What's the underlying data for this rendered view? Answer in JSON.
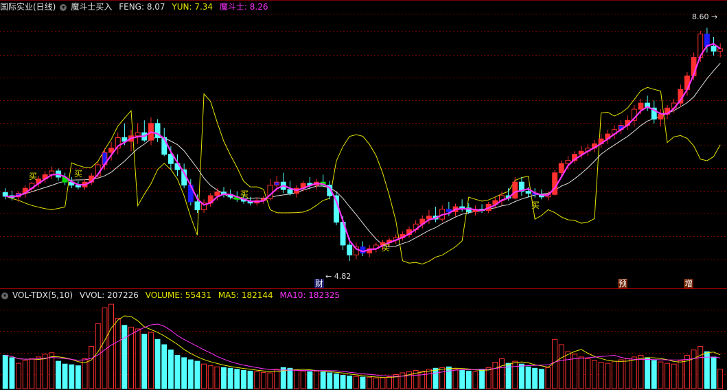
{
  "price_header": {
    "stock_name": "国际实业(日线)",
    "indicator_name": "魔斗士买入",
    "feng_label": "FENG: 8.07",
    "yun_label": "YUN: 7.34",
    "mods_label": "魔斗士: 8.26"
  },
  "volume_header": {
    "indicator_name": "VOL-TDX(5,10)",
    "vvol_label": "VVOL: 207226",
    "volume_label": "VOLUME: 55431",
    "ma5_label": "MA5: 182144",
    "ma10_label": "MA10: 182325"
  },
  "annotations": {
    "high_label": "8.60",
    "low_label": "4.82",
    "buy_signal": "买",
    "cai_marker": "财",
    "yu_marker": "预",
    "zeng_marker": "增"
  },
  "colors": {
    "background": "#000000",
    "grid": "#7a0000",
    "up_candle": "#ff3030",
    "down_candle": "#54ffff",
    "blue_candle": "#1c1cff",
    "green_candle": "#00e000",
    "red_candle": "#ff0000",
    "magenta_line": "#ff33ff",
    "white_line": "#e0e0e0",
    "yellow_line": "#e6e600",
    "header_white": "#e0e0e0",
    "header_yellow": "#e6e600",
    "header_magenta": "#ff33ff"
  },
  "chart_data": {
    "type": "candlestick",
    "title": "国际实业(日线)",
    "ylim": [
      4.6,
      8.85
    ],
    "volume_ylim": [
      0,
      250000
    ],
    "candles": [
      {
        "o": 5.93,
        "h": 6.0,
        "l": 5.82,
        "c": 5.87
      },
      {
        "o": 5.88,
        "h": 5.96,
        "l": 5.8,
        "c": 5.85
      },
      {
        "o": 5.86,
        "h": 5.95,
        "l": 5.78,
        "c": 5.92
      },
      {
        "o": 5.92,
        "h": 6.05,
        "l": 5.85,
        "c": 6.0
      },
      {
        "o": 6.0,
        "h": 6.1,
        "l": 5.95,
        "c": 6.08
      },
      {
        "o": 6.08,
        "h": 6.2,
        "l": 6.02,
        "c": 6.15
      },
      {
        "o": 6.15,
        "h": 6.28,
        "l": 6.08,
        "c": 6.22
      },
      {
        "o": 6.22,
        "h": 6.35,
        "l": 6.15,
        "c": 6.28
      },
      {
        "o": 6.28,
        "h": 6.32,
        "l": 6.12,
        "c": 6.18
      },
      {
        "o": 6.18,
        "h": 6.25,
        "l": 6.05,
        "c": 6.1
      },
      {
        "o": 6.1,
        "h": 6.18,
        "l": 6.0,
        "c": 6.05
      },
      {
        "o": 6.05,
        "h": 6.12,
        "l": 5.98,
        "c": 6.02
      },
      {
        "o": 6.02,
        "h": 6.15,
        "l": 5.97,
        "c": 6.1
      },
      {
        "o": 6.1,
        "h": 6.25,
        "l": 6.05,
        "c": 6.2
      },
      {
        "o": 6.2,
        "h": 6.42,
        "l": 6.15,
        "c": 6.38
      },
      {
        "o": 6.38,
        "h": 6.65,
        "l": 6.3,
        "c": 6.58
      },
      {
        "o": 6.58,
        "h": 6.75,
        "l": 6.45,
        "c": 6.65
      },
      {
        "o": 6.65,
        "h": 6.9,
        "l": 6.55,
        "c": 6.82
      },
      {
        "o": 6.82,
        "h": 7.05,
        "l": 6.7,
        "c": 6.76
      },
      {
        "o": 6.76,
        "h": 6.95,
        "l": 6.6,
        "c": 6.85
      },
      {
        "o": 6.85,
        "h": 7.05,
        "l": 6.72,
        "c": 6.9
      },
      {
        "o": 6.9,
        "h": 7.1,
        "l": 6.75,
        "c": 6.78
      },
      {
        "o": 6.78,
        "h": 7.15,
        "l": 6.7,
        "c": 7.05
      },
      {
        "o": 7.05,
        "h": 7.12,
        "l": 6.75,
        "c": 6.82
      },
      {
        "o": 6.82,
        "h": 6.98,
        "l": 6.52,
        "c": 6.55
      },
      {
        "o": 6.55,
        "h": 6.68,
        "l": 6.3,
        "c": 6.4
      },
      {
        "o": 6.4,
        "h": 6.55,
        "l": 6.2,
        "c": 6.3
      },
      {
        "o": 6.3,
        "h": 6.4,
        "l": 6.0,
        "c": 6.05
      },
      {
        "o": 6.05,
        "h": 6.15,
        "l": 5.72,
        "c": 5.78
      },
      {
        "o": 5.78,
        "h": 5.9,
        "l": 5.6,
        "c": 5.65
      },
      {
        "o": 5.65,
        "h": 5.82,
        "l": 5.6,
        "c": 5.76
      },
      {
        "o": 5.76,
        "h": 5.92,
        "l": 5.7,
        "c": 5.88
      },
      {
        "o": 5.88,
        "h": 6.0,
        "l": 5.8,
        "c": 5.94
      },
      {
        "o": 5.94,
        "h": 6.02,
        "l": 5.85,
        "c": 5.9
      },
      {
        "o": 5.9,
        "h": 5.98,
        "l": 5.82,
        "c": 5.86
      },
      {
        "o": 5.86,
        "h": 5.95,
        "l": 5.78,
        "c": 5.82
      },
      {
        "o": 5.82,
        "h": 5.9,
        "l": 5.75,
        "c": 5.79
      },
      {
        "o": 5.79,
        "h": 5.86,
        "l": 5.72,
        "c": 5.76
      },
      {
        "o": 5.76,
        "h": 5.85,
        "l": 5.72,
        "c": 5.8
      },
      {
        "o": 5.8,
        "h": 5.88,
        "l": 5.75,
        "c": 5.83
      },
      {
        "o": 5.83,
        "h": 6.15,
        "l": 5.8,
        "c": 6.05
      },
      {
        "o": 6.05,
        "h": 6.2,
        "l": 5.95,
        "c": 6.1
      },
      {
        "o": 6.1,
        "h": 6.25,
        "l": 5.92,
        "c": 5.98
      },
      {
        "o": 5.98,
        "h": 6.12,
        "l": 5.88,
        "c": 5.92
      },
      {
        "o": 5.92,
        "h": 6.05,
        "l": 5.85,
        "c": 6.0
      },
      {
        "o": 6.0,
        "h": 6.12,
        "l": 5.95,
        "c": 6.08
      },
      {
        "o": 6.08,
        "h": 6.18,
        "l": 6.0,
        "c": 6.05
      },
      {
        "o": 6.05,
        "h": 6.15,
        "l": 5.98,
        "c": 6.1
      },
      {
        "o": 6.1,
        "h": 6.22,
        "l": 6.02,
        "c": 6.05
      },
      {
        "o": 6.05,
        "h": 6.12,
        "l": 5.82,
        "c": 5.88
      },
      {
        "o": 5.88,
        "h": 5.95,
        "l": 5.4,
        "c": 5.45
      },
      {
        "o": 5.45,
        "h": 5.55,
        "l": 5.0,
        "c": 5.08
      },
      {
        "o": 5.08,
        "h": 5.2,
        "l": 4.82,
        "c": 4.92
      },
      {
        "o": 4.92,
        "h": 5.12,
        "l": 4.85,
        "c": 5.05
      },
      {
        "o": 5.05,
        "h": 5.14,
        "l": 4.9,
        "c": 4.95
      },
      {
        "o": 4.95,
        "h": 5.08,
        "l": 4.88,
        "c": 5.02
      },
      {
        "o": 5.02,
        "h": 5.12,
        "l": 4.96,
        "c": 5.08
      },
      {
        "o": 5.08,
        "h": 5.16,
        "l": 5.0,
        "c": 5.12
      },
      {
        "o": 5.12,
        "h": 5.2,
        "l": 5.06,
        "c": 5.16
      },
      {
        "o": 5.16,
        "h": 5.25,
        "l": 5.1,
        "c": 5.2
      },
      {
        "o": 5.2,
        "h": 5.3,
        "l": 5.15,
        "c": 5.25
      },
      {
        "o": 5.25,
        "h": 5.38,
        "l": 5.2,
        "c": 5.33
      },
      {
        "o": 5.33,
        "h": 5.48,
        "l": 5.28,
        "c": 5.42
      },
      {
        "o": 5.42,
        "h": 5.56,
        "l": 5.35,
        "c": 5.5
      },
      {
        "o": 5.5,
        "h": 5.65,
        "l": 5.42,
        "c": 5.55
      },
      {
        "o": 5.55,
        "h": 5.7,
        "l": 5.45,
        "c": 5.5
      },
      {
        "o": 5.5,
        "h": 5.72,
        "l": 5.46,
        "c": 5.66
      },
      {
        "o": 5.66,
        "h": 5.78,
        "l": 5.55,
        "c": 5.62
      },
      {
        "o": 5.62,
        "h": 5.75,
        "l": 5.55,
        "c": 5.7
      },
      {
        "o": 5.7,
        "h": 5.82,
        "l": 5.62,
        "c": 5.68
      },
      {
        "o": 5.68,
        "h": 5.76,
        "l": 5.58,
        "c": 5.62
      },
      {
        "o": 5.62,
        "h": 5.72,
        "l": 5.56,
        "c": 5.66
      },
      {
        "o": 5.66,
        "h": 5.74,
        "l": 5.6,
        "c": 5.64
      },
      {
        "o": 5.64,
        "h": 5.78,
        "l": 5.6,
        "c": 5.74
      },
      {
        "o": 5.74,
        "h": 5.86,
        "l": 5.68,
        "c": 5.8
      },
      {
        "o": 5.8,
        "h": 5.94,
        "l": 5.72,
        "c": 5.88
      },
      {
        "o": 5.88,
        "h": 6.0,
        "l": 5.8,
        "c": 5.84
      },
      {
        "o": 5.84,
        "h": 6.18,
        "l": 5.82,
        "c": 6.1
      },
      {
        "o": 6.1,
        "h": 6.18,
        "l": 5.88,
        "c": 5.95
      },
      {
        "o": 5.95,
        "h": 6.02,
        "l": 5.85,
        "c": 5.92
      },
      {
        "o": 5.92,
        "h": 6.0,
        "l": 5.85,
        "c": 5.9
      },
      {
        "o": 5.9,
        "h": 5.98,
        "l": 5.82,
        "c": 5.86
      },
      {
        "o": 5.86,
        "h": 5.95,
        "l": 5.8,
        "c": 5.9
      },
      {
        "o": 5.9,
        "h": 6.3,
        "l": 5.88,
        "c": 6.25
      },
      {
        "o": 6.25,
        "h": 6.45,
        "l": 6.2,
        "c": 6.4
      },
      {
        "o": 6.4,
        "h": 6.52,
        "l": 6.3,
        "c": 6.45
      },
      {
        "o": 6.45,
        "h": 6.6,
        "l": 6.4,
        "c": 6.55
      },
      {
        "o": 6.55,
        "h": 6.68,
        "l": 6.48,
        "c": 6.6
      },
      {
        "o": 6.6,
        "h": 6.72,
        "l": 6.52,
        "c": 6.65
      },
      {
        "o": 6.65,
        "h": 6.78,
        "l": 6.58,
        "c": 6.72
      },
      {
        "o": 6.72,
        "h": 6.88,
        "l": 6.65,
        "c": 6.8
      },
      {
        "o": 6.8,
        "h": 6.95,
        "l": 6.72,
        "c": 6.88
      },
      {
        "o": 6.88,
        "h": 7.02,
        "l": 6.8,
        "c": 6.95
      },
      {
        "o": 6.95,
        "h": 7.1,
        "l": 6.88,
        "c": 7.02
      },
      {
        "o": 7.02,
        "h": 7.18,
        "l": 6.95,
        "c": 7.1
      },
      {
        "o": 7.1,
        "h": 7.35,
        "l": 7.0,
        "c": 7.28
      },
      {
        "o": 7.28,
        "h": 7.45,
        "l": 7.2,
        "c": 7.38
      },
      {
        "o": 7.38,
        "h": 7.5,
        "l": 7.25,
        "c": 7.3
      },
      {
        "o": 7.3,
        "h": 7.42,
        "l": 7.05,
        "c": 7.12
      },
      {
        "o": 7.12,
        "h": 7.28,
        "l": 7.0,
        "c": 7.2
      },
      {
        "o": 7.2,
        "h": 7.35,
        "l": 7.12,
        "c": 7.3
      },
      {
        "o": 7.3,
        "h": 7.45,
        "l": 7.22,
        "c": 7.38
      },
      {
        "o": 7.38,
        "h": 7.68,
        "l": 7.32,
        "c": 7.6
      },
      {
        "o": 7.6,
        "h": 7.88,
        "l": 7.5,
        "c": 7.82
      },
      {
        "o": 7.82,
        "h": 8.2,
        "l": 7.75,
        "c": 8.12
      },
      {
        "o": 8.12,
        "h": 8.55,
        "l": 8.05,
        "c": 8.5
      },
      {
        "o": 8.5,
        "h": 8.6,
        "l": 8.2,
        "c": 8.3
      },
      {
        "o": 8.3,
        "h": 8.45,
        "l": 8.15,
        "c": 8.22
      },
      {
        "o": 8.22,
        "h": 8.35,
        "l": 8.12,
        "c": 8.26
      }
    ],
    "volume": [
      95000,
      88000,
      72000,
      80000,
      85000,
      90000,
      98000,
      102000,
      78000,
      70000,
      68000,
      65000,
      85000,
      120000,
      185000,
      230000,
      240000,
      200000,
      180000,
      175000,
      170000,
      155000,
      160000,
      140000,
      125000,
      110000,
      95000,
      88000,
      82000,
      78000,
      70000,
      65000,
      62000,
      60000,
      58000,
      55000,
      52000,
      50000,
      48000,
      46000,
      45000,
      55000,
      60000,
      58000,
      52000,
      50000,
      48000,
      50000,
      47000,
      45000,
      42000,
      38000,
      36000,
      35000,
      33000,
      32000,
      30000,
      31000,
      34000,
      40000,
      45000,
      48000,
      52000,
      50000,
      55000,
      58000,
      60000,
      62000,
      55000,
      52000,
      50000,
      48000,
      55000,
      60000,
      75000,
      85000,
      72000,
      78000,
      70000,
      62000,
      58000,
      55000,
      60000,
      140000,
      125000,
      105000,
      98000,
      90000,
      85000,
      80000,
      75000,
      72000,
      78000,
      82000,
      85000,
      90000,
      95000,
      88000,
      80000,
      76000,
      72000,
      70000,
      80000,
      95000,
      110000,
      120000,
      105000,
      90000,
      55431
    ],
    "series": []
  }
}
